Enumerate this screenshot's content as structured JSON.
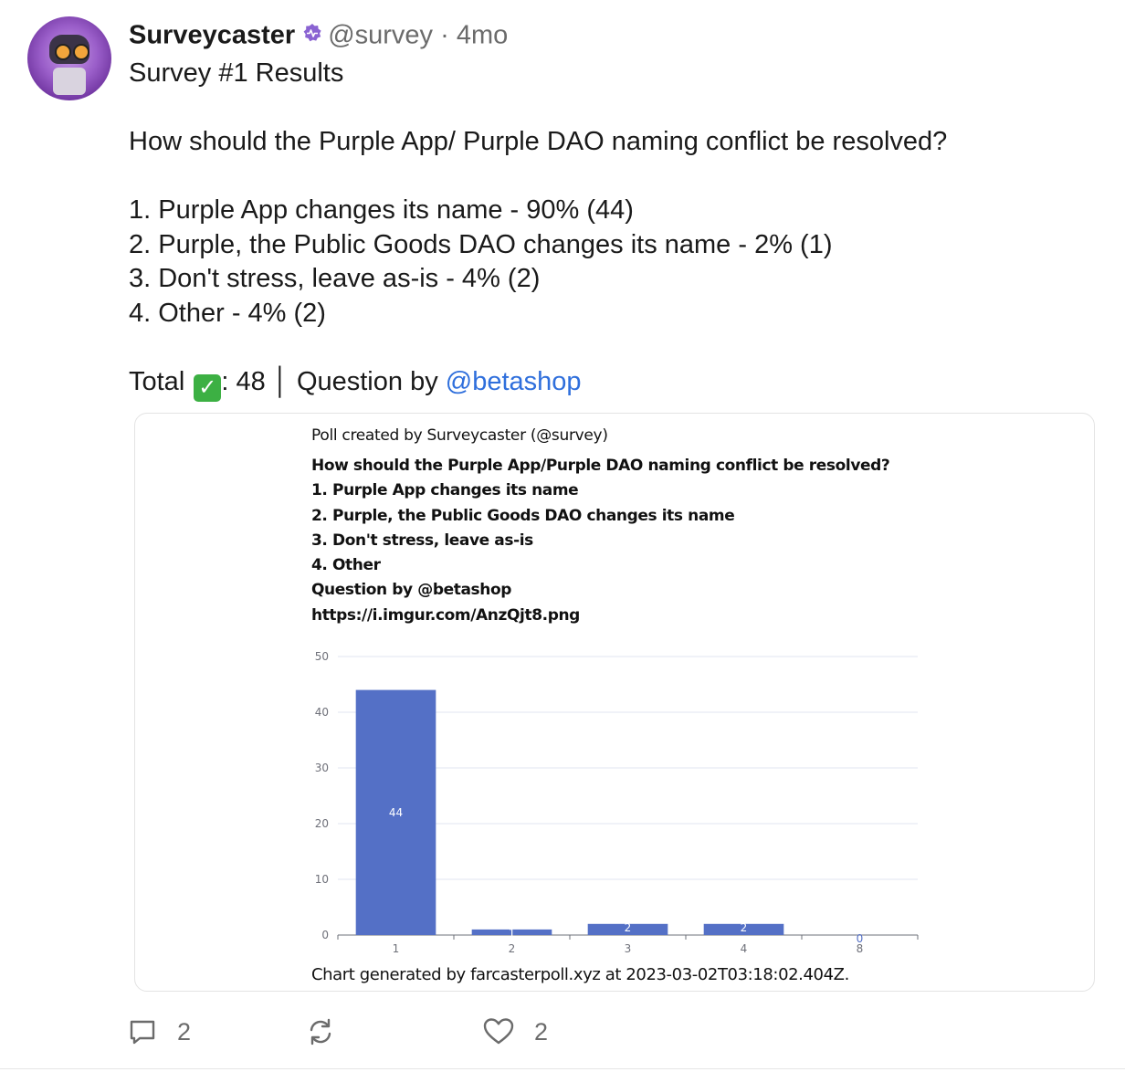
{
  "post": {
    "display_name": "Surveycaster",
    "handle": "@survey",
    "separator": "·",
    "time": "4mo",
    "lines": [
      "Survey #1 Results",
      "",
      "How should the Purple App/ Purple DAO naming conflict be resolved?",
      "",
      "1. Purple App changes its name - 90% (44)",
      "2. Purple, the Public Goods DAO changes its name - 2% (1)",
      "3. Don't stress, leave as-is - 4% (2)",
      "4. Other - 4% (2)",
      ""
    ],
    "total_prefix": "Total ",
    "total_suffix": ": 48 │ Question by ",
    "mention": "@betashop"
  },
  "embed": {
    "credit": "Poll created by Surveycaster (@survey)",
    "lines": [
      "How should the Purple App/Purple DAO naming conflict be resolved?",
      "1. Purple App changes its name",
      "2. Purple, the Public Goods DAO changes its name",
      "3. Don't stress, leave as-is",
      "4. Other",
      "Question by @betashop",
      "https://i.imgur.com/AnzQjt8.png"
    ],
    "footer": "Chart generated by farcasterpoll.xyz at 2023-03-02T03:18:02.404Z."
  },
  "chart_data": {
    "type": "bar",
    "categories": [
      "1",
      "2",
      "3",
      "4",
      "8"
    ],
    "values": [
      44,
      1,
      2,
      2,
      0
    ],
    "data_labels": [
      "44",
      "1",
      "2",
      "2",
      "0"
    ],
    "ylim": [
      0,
      50
    ],
    "yticks": [
      0,
      10,
      20,
      30,
      40,
      50
    ],
    "grid": true,
    "bar_color": "#5470c6",
    "title": "",
    "xlabel": "",
    "ylabel": ""
  },
  "actions": {
    "reply_count": "2",
    "like_count": "2"
  },
  "colors": {
    "mention": "#2f6fdc",
    "badge": "#8a63d2",
    "check": "#3cb043"
  }
}
